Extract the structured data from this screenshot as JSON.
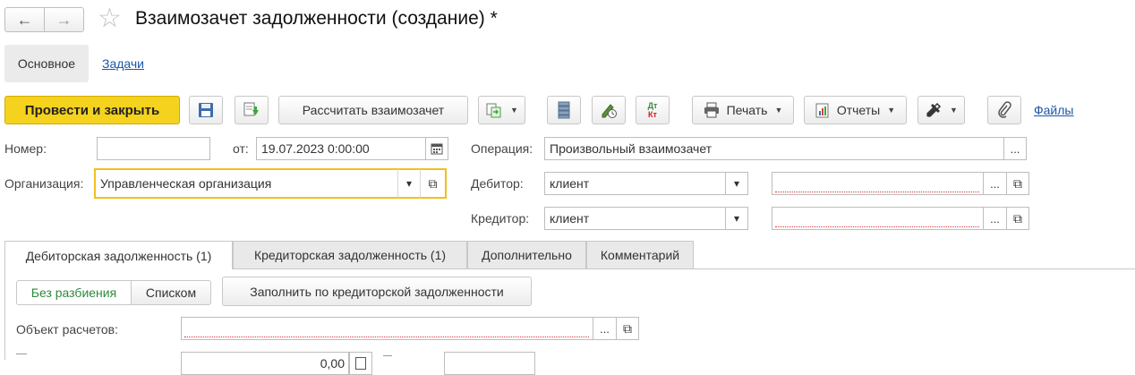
{
  "window": {
    "title": "Взаимозачет задолженности (создание) *"
  },
  "nav": {
    "back": "←",
    "forward": "→",
    "favorite": "☆"
  },
  "sections": {
    "main": "Основное",
    "tasks": "Задачи"
  },
  "toolbar": {
    "post_close": "Провести и закрыть",
    "calculate": "Рассчитать взаимозачет",
    "dt_kt_top": "Дт",
    "dt_kt_bottom": "Кт",
    "print": "Печать",
    "reports": "Отчеты",
    "files": "Файлы",
    "colors": {
      "primary": "#f5d21e",
      "link": "#1c57a5",
      "highlight": "#f0c020"
    }
  },
  "form": {
    "number_label": "Номер:",
    "number_value": "",
    "date_label": "от:",
    "date_value": "19.07.2023  0:00:00",
    "operation_label": "Операция:",
    "operation_value": "Произвольный взаимозачет",
    "org_label": "Организация:",
    "org_value": "Управленческая организация",
    "debtor_label": "Дебитор:",
    "debtor_value": "клиент",
    "debtor_contract": "",
    "creditor_label": "Кредитор:",
    "creditor_value": "клиент",
    "creditor_contract": ""
  },
  "tabs": [
    {
      "label": "Дебиторская задолженность (1)",
      "active": true
    },
    {
      "label": "Кредиторская задолженность (1)",
      "active": false
    },
    {
      "label": "Дополнительно",
      "active": false
    },
    {
      "label": "Комментарий",
      "active": false
    }
  ],
  "tab_content": {
    "mode_split": "Без разбиения",
    "mode_list": "Списком",
    "fill_button": "Заполнить по кредиторской задолженности",
    "object_label": "Объект расчетов:",
    "object_value": "",
    "amount_value": "0,00"
  },
  "icons": {
    "ellipsis": "...",
    "open": "⧉",
    "dropdown": "▾",
    "calendar": "calendar-icon"
  }
}
